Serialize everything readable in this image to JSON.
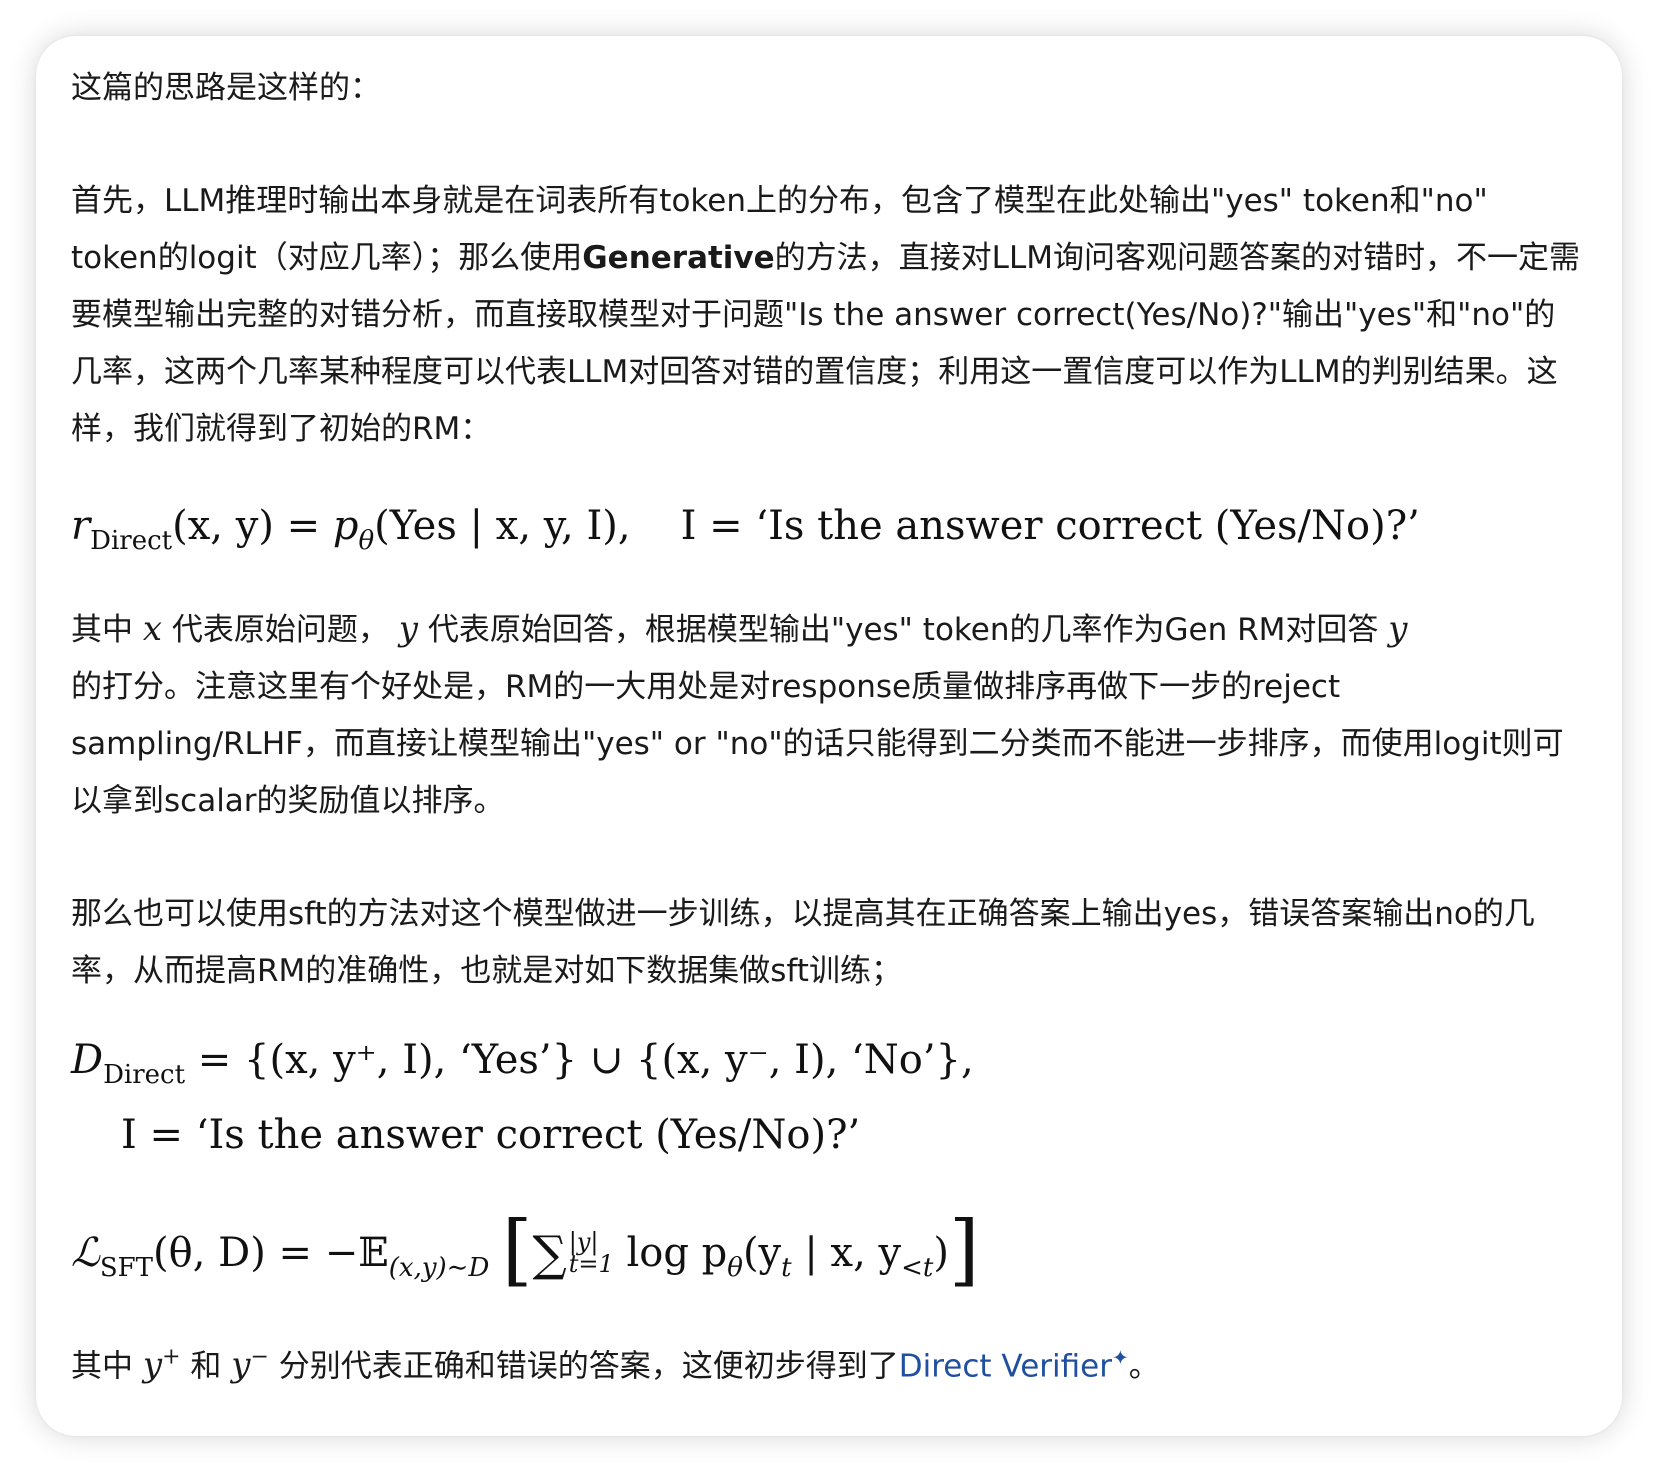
{
  "intro": "这篇的思路是这样的：",
  "para1": {
    "part1": "首先，LLM推理时输出本身就是在词表所有token上的分布，包含了模型在此处输出\"yes\" token和\"no\" token的logit（对应几率）；那么使用",
    "bold": "Generative",
    "part2": "的方法，直接对LLM询问客观问题答案的对错时，不一定需要模型输出完整的对错分析，而直接取模型对于问题\"Is the answer correct(Yes/No)?\"输出\"yes\"和\"no\"的几率，这两个几率某种程度可以代表LLM对回答对错的置信度；利用这一置信度可以作为LLM的判别结果。这样，我们就得到了初始的RM："
  },
  "eq1": {
    "r": "r",
    "r_sub": "Direct",
    "lhs_args": "(x, y) = ",
    "p": "p",
    "p_sub": "θ",
    "rhs": "(Yes | x, y, I),",
    "instr": "I = ‘Is the answer correct (Yes/No)?’"
  },
  "para2": {
    "t1": "其中",
    "x": "x",
    "t2": "代表原始问题，",
    "y": "y",
    "t3": "代表原始回答，根据模型输出\"yes\" token的几率作为Gen RM对回答",
    "y2": "y",
    "t4": "的打分。注意这里有个好处是，RM的一大用处是对response质量做排序再做下一步的reject sampling/RLHF，而直接让模型输出\"yes\" or \"no\"的话只能得到二分类而不能进一步排序，而使用logit则可以拿到scalar的奖励值以排序。"
  },
  "para3": "那么也可以使用sft的方法对这个模型做进一步训练，以提高其在正确答案上输出yes，错误答案输出no的几率，从而提高RM的准确性，也就是对如下数据集做sft训练；",
  "eq2": {
    "D": "D",
    "D_sub": "Direct",
    "line1": "= {(x, y⁺, I), ‘Yes’} ∪ {(x, y⁻, I), ‘No’},",
    "line2": "I = ‘Is the answer correct (Yes/No)?’"
  },
  "eq3": {
    "L": "ℒ",
    "L_sub": "SFT",
    "args": "(θ, D) = −𝔼",
    "E_sub": "(x,y)∼D",
    "sum_sup": "|y|",
    "sum_sub": "t=1",
    "body": "log p",
    "body_sub": "θ",
    "body_args": "(y",
    "yt_sub": "t",
    "tail": " | x, y",
    "ylt_sub": "<t",
    "close": ")"
  },
  "para4": {
    "t1": "其中",
    "yplus": "y",
    "plus": "+",
    "t2": "和",
    "yminus": "y",
    "minus": "−",
    "t3": "分别代表正确和错误的答案，这便初步得到了",
    "link": "Direct Verifier",
    "end": "。"
  }
}
